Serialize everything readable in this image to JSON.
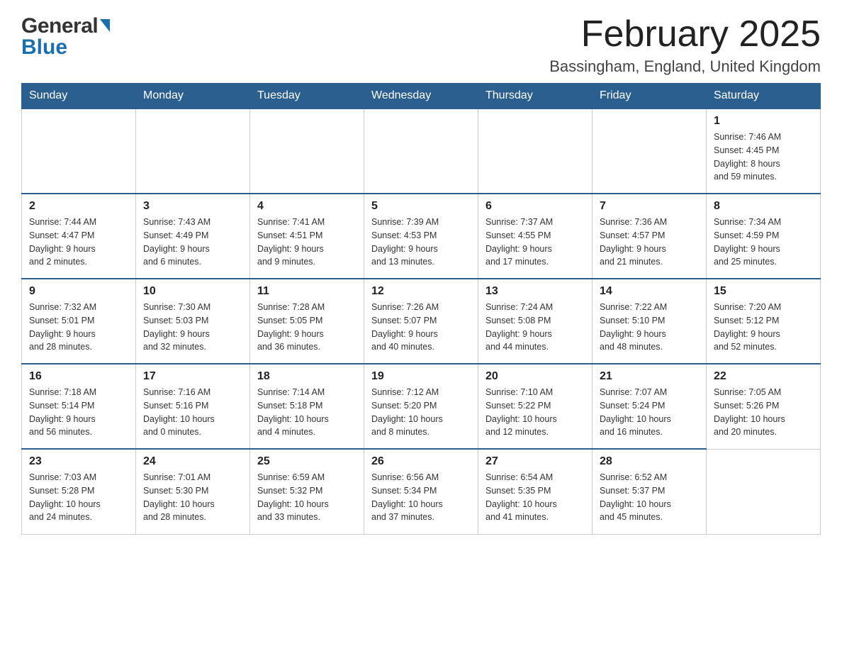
{
  "header": {
    "logo_general": "General",
    "logo_blue": "Blue",
    "title": "February 2025",
    "subtitle": "Bassingham, England, United Kingdom"
  },
  "days_of_week": [
    "Sunday",
    "Monday",
    "Tuesday",
    "Wednesday",
    "Thursday",
    "Friday",
    "Saturday"
  ],
  "weeks": [
    {
      "days": [
        {
          "number": "",
          "info": ""
        },
        {
          "number": "",
          "info": ""
        },
        {
          "number": "",
          "info": ""
        },
        {
          "number": "",
          "info": ""
        },
        {
          "number": "",
          "info": ""
        },
        {
          "number": "",
          "info": ""
        },
        {
          "number": "1",
          "info": "Sunrise: 7:46 AM\nSunset: 4:45 PM\nDaylight: 8 hours\nand 59 minutes."
        }
      ]
    },
    {
      "days": [
        {
          "number": "2",
          "info": "Sunrise: 7:44 AM\nSunset: 4:47 PM\nDaylight: 9 hours\nand 2 minutes."
        },
        {
          "number": "3",
          "info": "Sunrise: 7:43 AM\nSunset: 4:49 PM\nDaylight: 9 hours\nand 6 minutes."
        },
        {
          "number": "4",
          "info": "Sunrise: 7:41 AM\nSunset: 4:51 PM\nDaylight: 9 hours\nand 9 minutes."
        },
        {
          "number": "5",
          "info": "Sunrise: 7:39 AM\nSunset: 4:53 PM\nDaylight: 9 hours\nand 13 minutes."
        },
        {
          "number": "6",
          "info": "Sunrise: 7:37 AM\nSunset: 4:55 PM\nDaylight: 9 hours\nand 17 minutes."
        },
        {
          "number": "7",
          "info": "Sunrise: 7:36 AM\nSunset: 4:57 PM\nDaylight: 9 hours\nand 21 minutes."
        },
        {
          "number": "8",
          "info": "Sunrise: 7:34 AM\nSunset: 4:59 PM\nDaylight: 9 hours\nand 25 minutes."
        }
      ]
    },
    {
      "days": [
        {
          "number": "9",
          "info": "Sunrise: 7:32 AM\nSunset: 5:01 PM\nDaylight: 9 hours\nand 28 minutes."
        },
        {
          "number": "10",
          "info": "Sunrise: 7:30 AM\nSunset: 5:03 PM\nDaylight: 9 hours\nand 32 minutes."
        },
        {
          "number": "11",
          "info": "Sunrise: 7:28 AM\nSunset: 5:05 PM\nDaylight: 9 hours\nand 36 minutes."
        },
        {
          "number": "12",
          "info": "Sunrise: 7:26 AM\nSunset: 5:07 PM\nDaylight: 9 hours\nand 40 minutes."
        },
        {
          "number": "13",
          "info": "Sunrise: 7:24 AM\nSunset: 5:08 PM\nDaylight: 9 hours\nand 44 minutes."
        },
        {
          "number": "14",
          "info": "Sunrise: 7:22 AM\nSunset: 5:10 PM\nDaylight: 9 hours\nand 48 minutes."
        },
        {
          "number": "15",
          "info": "Sunrise: 7:20 AM\nSunset: 5:12 PM\nDaylight: 9 hours\nand 52 minutes."
        }
      ]
    },
    {
      "days": [
        {
          "number": "16",
          "info": "Sunrise: 7:18 AM\nSunset: 5:14 PM\nDaylight: 9 hours\nand 56 minutes."
        },
        {
          "number": "17",
          "info": "Sunrise: 7:16 AM\nSunset: 5:16 PM\nDaylight: 10 hours\nand 0 minutes."
        },
        {
          "number": "18",
          "info": "Sunrise: 7:14 AM\nSunset: 5:18 PM\nDaylight: 10 hours\nand 4 minutes."
        },
        {
          "number": "19",
          "info": "Sunrise: 7:12 AM\nSunset: 5:20 PM\nDaylight: 10 hours\nand 8 minutes."
        },
        {
          "number": "20",
          "info": "Sunrise: 7:10 AM\nSunset: 5:22 PM\nDaylight: 10 hours\nand 12 minutes."
        },
        {
          "number": "21",
          "info": "Sunrise: 7:07 AM\nSunset: 5:24 PM\nDaylight: 10 hours\nand 16 minutes."
        },
        {
          "number": "22",
          "info": "Sunrise: 7:05 AM\nSunset: 5:26 PM\nDaylight: 10 hours\nand 20 minutes."
        }
      ]
    },
    {
      "days": [
        {
          "number": "23",
          "info": "Sunrise: 7:03 AM\nSunset: 5:28 PM\nDaylight: 10 hours\nand 24 minutes."
        },
        {
          "number": "24",
          "info": "Sunrise: 7:01 AM\nSunset: 5:30 PM\nDaylight: 10 hours\nand 28 minutes."
        },
        {
          "number": "25",
          "info": "Sunrise: 6:59 AM\nSunset: 5:32 PM\nDaylight: 10 hours\nand 33 minutes."
        },
        {
          "number": "26",
          "info": "Sunrise: 6:56 AM\nSunset: 5:34 PM\nDaylight: 10 hours\nand 37 minutes."
        },
        {
          "number": "27",
          "info": "Sunrise: 6:54 AM\nSunset: 5:35 PM\nDaylight: 10 hours\nand 41 minutes."
        },
        {
          "number": "28",
          "info": "Sunrise: 6:52 AM\nSunset: 5:37 PM\nDaylight: 10 hours\nand 45 minutes."
        },
        {
          "number": "",
          "info": ""
        }
      ]
    }
  ]
}
